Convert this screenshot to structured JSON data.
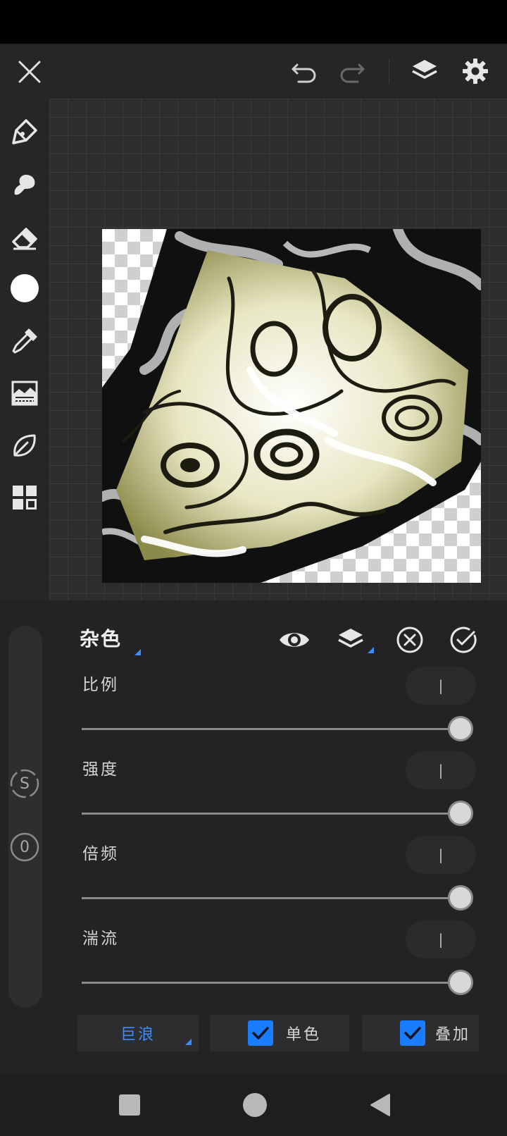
{
  "toolbar": {
    "close": "close-icon",
    "undo": "undo-icon",
    "redo": "redo-icon",
    "layers": "layers-icon",
    "settings": "gear-icon"
  },
  "tools": [
    "pen-icon",
    "smudge-icon",
    "eraser-icon",
    "color-swatch",
    "eyedropper-icon",
    "adjust-icon",
    "leaf-icon",
    "grid-icon"
  ],
  "side": {
    "size_badge": "S",
    "opacity_badge": "0"
  },
  "effect": {
    "title": "杂色",
    "params": [
      {
        "label": "比例",
        "value": "|",
        "level": 1.0
      },
      {
        "label": "强度",
        "value": "|",
        "level": 1.0
      },
      {
        "label": "倍频",
        "value": "|",
        "level": 1.0
      },
      {
        "label": "湍流",
        "value": "|",
        "level": 1.0
      }
    ],
    "options": {
      "mode": "巨浪",
      "mono_label": "单色",
      "mono_checked": true,
      "overlay_label": "叠加",
      "overlay_checked": true
    }
  },
  "colors": {
    "accent": "#1a7cff",
    "mode_text": "#3a8cff",
    "panel": "#232325",
    "canvas": "#2d2d30"
  }
}
